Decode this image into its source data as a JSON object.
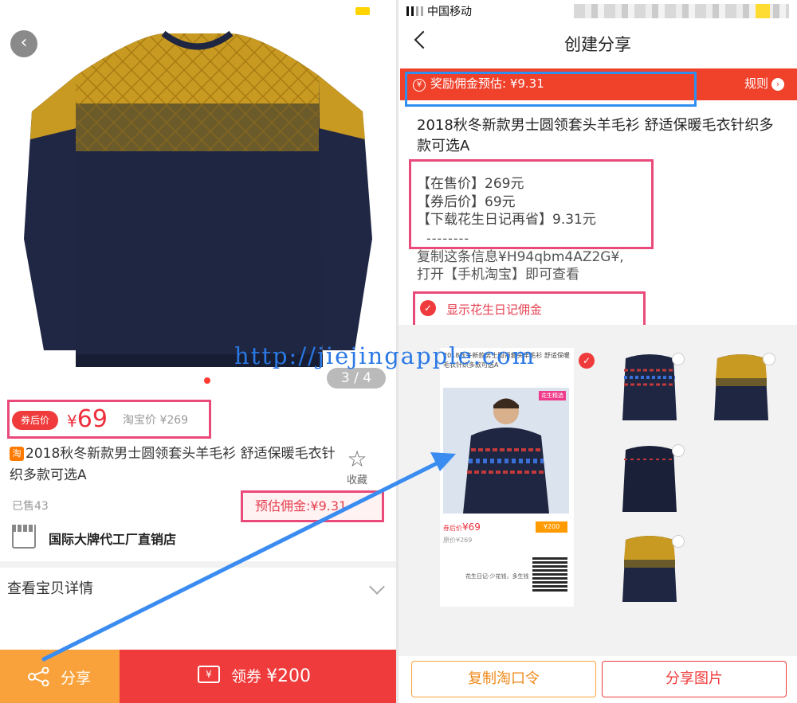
{
  "left": {
    "page_indicator": "3 / 4",
    "after_coupon_badge": "券后价",
    "price_symbol": "¥",
    "price": "69",
    "taobao_price": "淘宝价 ¥269",
    "taobao_icon": "淘",
    "title": "2018秋冬新款男士圆领套头羊毛衫 舒适保暖毛衣针织多款可选A",
    "favorite_label": "收藏",
    "sold": "已售43",
    "commission": "预估佣金:¥9.31",
    "store_name": "国际大牌代工厂直销店",
    "details": "查看宝贝详情",
    "share_label": "分享",
    "coupon_label": "领券",
    "coupon_amount": "¥200",
    "coupon_icon": "¥"
  },
  "right": {
    "carrier": "中国移动",
    "nav_title": "创建分享",
    "reward_icon": "¥",
    "reward": "奖励佣金预估: ¥9.31",
    "rules": "规则",
    "title": "2018秋冬新款男士圆领套头羊毛衫 舒适保暖毛衣针织多款可选A",
    "price_lines": [
      "【在售价】269元",
      "【券后价】69元",
      "【下载花生日记再省】9.31元"
    ],
    "dashes": "--------",
    "copy_lines": [
      "复制这条信息¥H94qbm4AZ2G¥,",
      "打开【手机淘宝】即可查看"
    ],
    "show_commission": "显示花生日记佣金",
    "preview": {
      "title": "2018秋冬新款男士圆领套头羊毛衫 舒适保暖毛衣针织多款可选A",
      "tag": "花生精选",
      "price_label": "券后价",
      "price": "¥69",
      "orig": "原价¥269",
      "coupon": "¥200",
      "footer": "花生日记-少花钱，多生钱"
    },
    "copy_button": "复制淘口令",
    "share_image_button": "分享图片"
  },
  "watermark": "http://jiejingapple.com",
  "colors": {
    "accent_red": "#ef3b3b",
    "orange": "#f9a23b",
    "highlight_pink": "#e94a7a",
    "highlight_blue": "#2f8ff0"
  },
  "icons": [
    "back-icon",
    "star-icon",
    "store-icon",
    "chevron-down-icon",
    "share-icon",
    "ticket-icon",
    "checkmark-icon",
    "rules-arrow-icon"
  ]
}
